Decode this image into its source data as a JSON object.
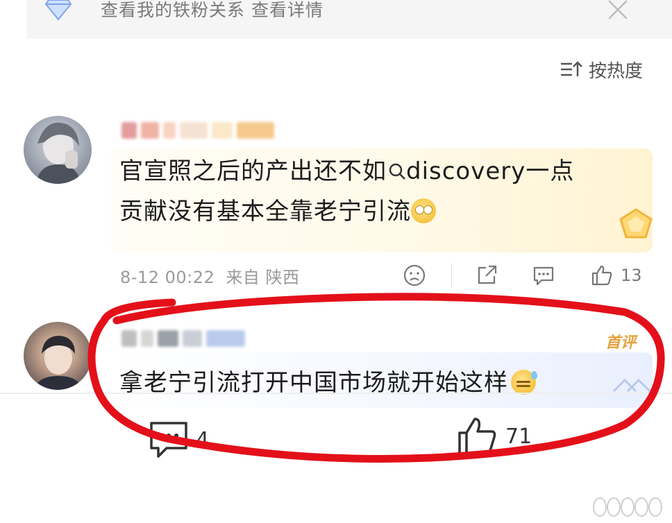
{
  "banner": {
    "text": "查看我的铁粉关系 查看详情"
  },
  "sort": {
    "label": "按热度"
  },
  "comment1": {
    "text_line1_a": "官宣照之后的产出还不如",
    "search_term": "discovery",
    "text_line1_b": "一点",
    "text_line2": "贡献没有基本全靠老宁引流",
    "time": "8-12 00:22",
    "source": "来自 陕西",
    "likes": "13"
  },
  "comment2": {
    "badge": "首评",
    "text": "拿老宁引流打开中国市场就开始这样",
    "comments": "4",
    "likes": "71"
  },
  "colors": {
    "accent_red": "#e3101a",
    "badge_gold": "#e5a03a"
  }
}
